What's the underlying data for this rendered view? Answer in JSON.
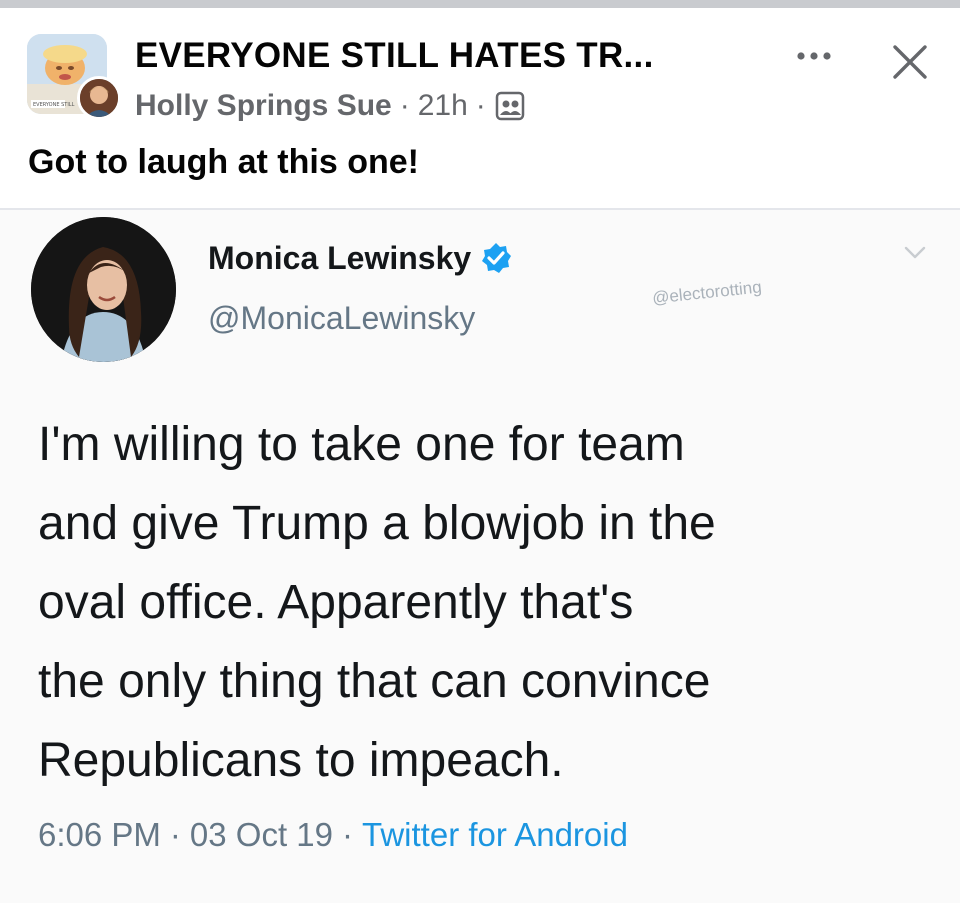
{
  "post": {
    "group_name": "EVERYONE STILL HATES TR...",
    "author": "Holly Springs Sue",
    "time": "21h",
    "separator": "·",
    "privacy_icon": "group-members-icon",
    "more_icon": "more-options-icon",
    "close_icon": "close-icon",
    "caption": "Got to laugh at this one!",
    "group_avatar_text": "EVERYONE STILL"
  },
  "tweet": {
    "display_name": "Monica Lewinsky",
    "handle": "@MonicaLewinsky",
    "verified_icon": "verified-badge-icon",
    "watermark": "@electorotting",
    "text_lines": [
      "I'm willing to take one for team",
      "and give Trump a blowjob in the",
      "oval office. Apparently that's",
      "the only thing that can convince",
      "Republicans to impeach."
    ],
    "time": "6:06 PM",
    "date": "03 Oct 19",
    "source": "Twitter for Android",
    "separator": "·"
  },
  "colors": {
    "primary_text": "#050505",
    "secondary_text": "#65676b",
    "tweet_text": "#14171a",
    "tweet_secondary": "#657786",
    "twitter_blue": "#1b95e0"
  }
}
